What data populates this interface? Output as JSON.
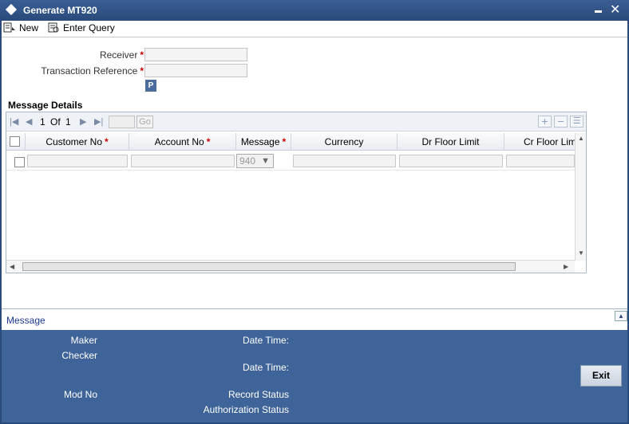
{
  "window": {
    "title": "Generate MT920"
  },
  "toolbar": {
    "new_label": "New",
    "enter_query_label": "Enter Query"
  },
  "form": {
    "receiver_label": "Receiver",
    "transaction_reference_label": "Transaction Reference",
    "receiver_value": "",
    "transaction_reference_value": "",
    "p_button_label": "P"
  },
  "message_details": {
    "title": "Message Details",
    "pagination": {
      "current": "1",
      "of_label": "Of",
      "total": "1",
      "go_label": "Go"
    },
    "columns": [
      "Customer No",
      "Account No",
      "Message",
      "Currency",
      "Dr Floor Limit",
      "Cr Floor Limit"
    ],
    "required_mark": "*",
    "rows": [
      {
        "customer_no": "",
        "account_no": "",
        "message": "940",
        "currency": "",
        "dr_floor_limit": "",
        "cr_floor_limit": ""
      }
    ]
  },
  "message_bar": {
    "label": "Message"
  },
  "footer": {
    "maker_label": "Maker",
    "checker_label": "Checker",
    "mod_no_label": "Mod No",
    "date_time_label_1": "Date Time:",
    "date_time_label_2": "Date Time:",
    "record_status_label": "Record Status",
    "authorization_status_label": "Authorization Status",
    "exit_label": "Exit"
  },
  "colors": {
    "titlebar": "#2a4a7b",
    "footer": "#3f6499",
    "required": "#cc0000",
    "link": "#1a3a8c"
  }
}
